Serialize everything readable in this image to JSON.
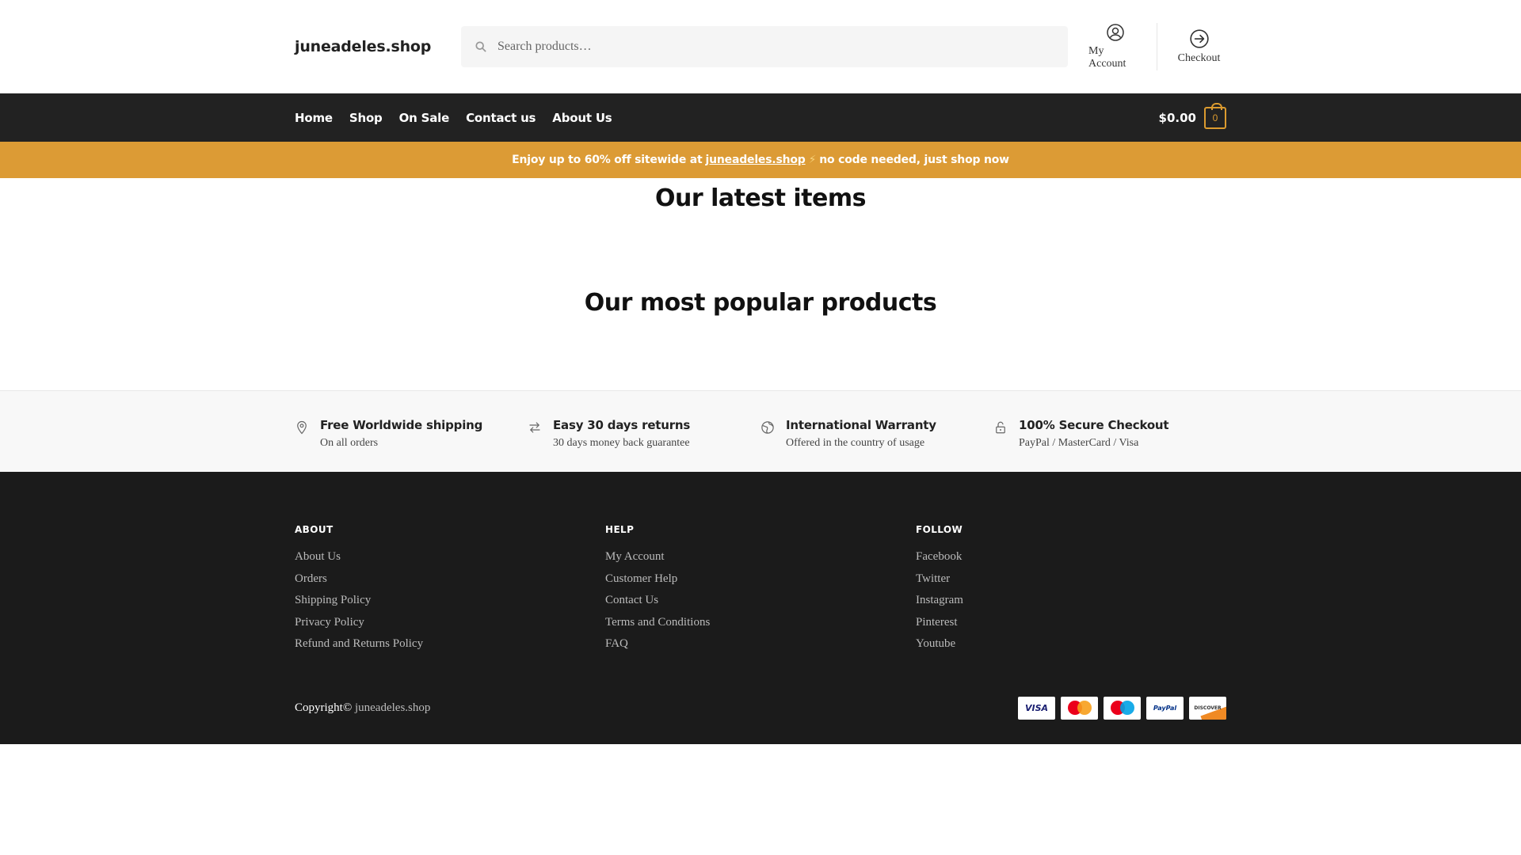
{
  "header": {
    "logo": "juneadeles.shop",
    "search_placeholder": "Search products…",
    "account_label": "My Account",
    "checkout_label": "Checkout"
  },
  "nav": {
    "items": [
      "Home",
      "Shop",
      "On Sale",
      "Contact us",
      "About Us"
    ],
    "cart_amount": "$0.00",
    "cart_count": "0"
  },
  "promo": {
    "text_before": "Enjoy up to 60% off sitewide at",
    "link": "juneadeles.shop",
    "bolt": "⚡",
    "text_after": "no code needed, just shop now"
  },
  "sections": {
    "latest_title": "Our latest items",
    "popular_title": "Our most popular products"
  },
  "features": [
    {
      "icon": "map-pin-icon",
      "title": "Free Worldwide shipping",
      "subtitle": "On all orders"
    },
    {
      "icon": "arrows-exchange-icon",
      "title": "Easy 30 days returns",
      "subtitle": "30 days money back guarantee"
    },
    {
      "icon": "globe-icon",
      "title": "International Warranty",
      "subtitle": "Offered in the country of usage"
    },
    {
      "icon": "lock-icon",
      "title": "100% Secure Checkout",
      "subtitle": "PayPal / MasterCard / Visa"
    }
  ],
  "footer": {
    "columns": [
      {
        "title": "ABOUT",
        "links": [
          "About Us",
          "Orders",
          "Shipping Policy",
          "Privacy Policy",
          "Refund and Returns Policy"
        ]
      },
      {
        "title": "HELP",
        "links": [
          "My Account",
          "Customer Help",
          "Contact Us",
          "Terms and Conditions",
          "FAQ"
        ]
      },
      {
        "title": "FOLLOW",
        "links": [
          "Facebook",
          "Twitter",
          "Instagram",
          "Pinterest",
          "Youtube"
        ]
      }
    ],
    "copyright_prefix": "Copyright©",
    "copyright_site": "juneadeles.shop",
    "payments": {
      "visa": "VISA",
      "mastercard": "MasterCard",
      "maestro": "Maestro",
      "paypal": "PayPal",
      "discover": "DISCOVER"
    }
  },
  "colors": {
    "accent": "#dc9b35",
    "nav_bg": "#222222",
    "footer_bg": "#1b1b1b"
  }
}
